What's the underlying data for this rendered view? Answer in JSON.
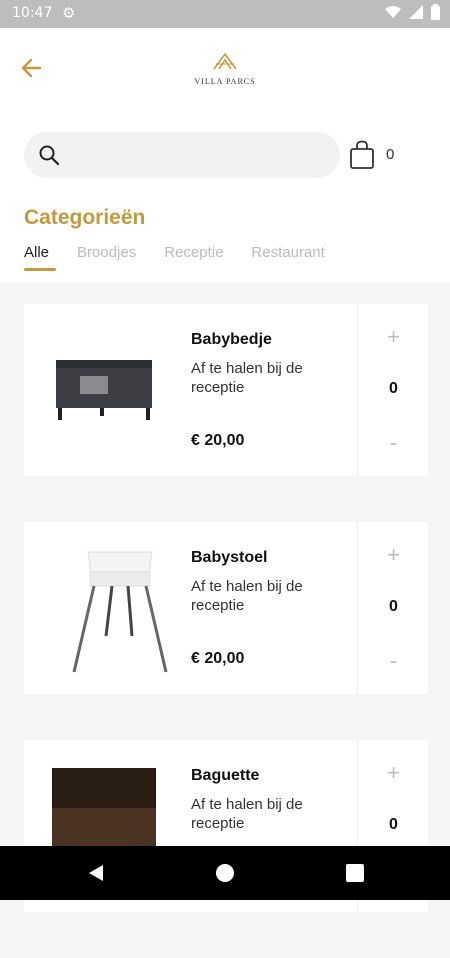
{
  "status": {
    "time": "10:47",
    "icons": [
      "settings-icon",
      "wifi-icon",
      "signal-icon",
      "battery-icon"
    ]
  },
  "header": {
    "back_icon": "arrow-left-icon",
    "logo_text": "VILLA PARCS",
    "search_placeholder": "",
    "cart_count": "0"
  },
  "categories": {
    "title": "Categorieën",
    "tabs": [
      {
        "label": "Alle",
        "active": true
      },
      {
        "label": "Broodjes"
      },
      {
        "label": "Receptie"
      },
      {
        "label": "Restaurant"
      }
    ]
  },
  "products": [
    {
      "name": "Babybedje",
      "description": "Af te halen bij de receptie",
      "price": "€ 20,00",
      "quantity": "0",
      "plus": "+",
      "minus": "-"
    },
    {
      "name": "Babystoel",
      "description": "Af te halen bij de receptie",
      "price": "€ 20,00",
      "quantity": "0",
      "plus": "+",
      "minus": "-"
    },
    {
      "name": "Baguette",
      "description": "Af te halen bij de receptie",
      "price": "",
      "quantity": "0",
      "plus": "+",
      "minus": "-"
    }
  ],
  "colors": {
    "accent": "#c39a3b"
  }
}
